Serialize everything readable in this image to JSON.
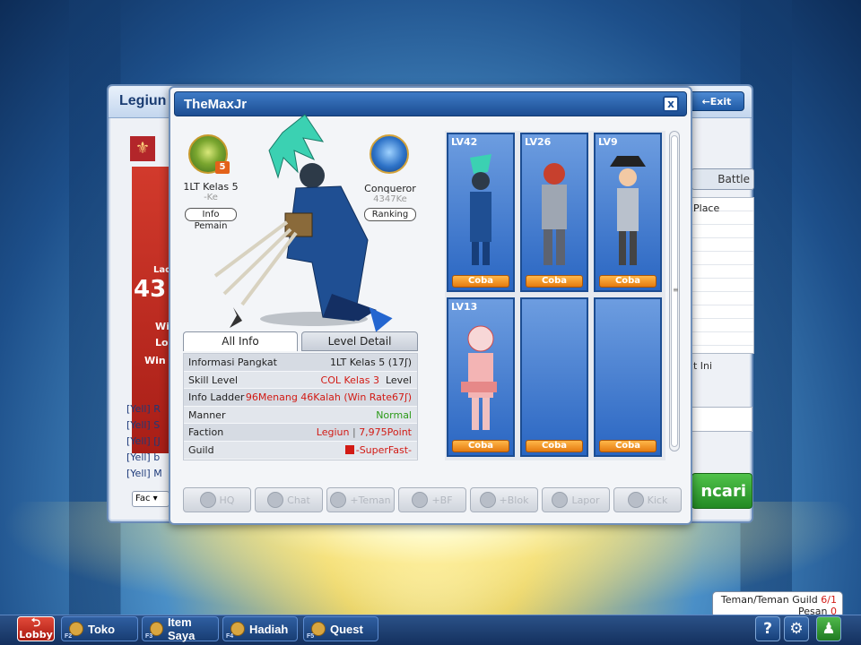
{
  "colors": {
    "accent": "#1c4d92",
    "red_text": "#d21a14",
    "green_text": "#2b9a18",
    "coba": "#e57b10"
  },
  "back_window": {
    "title": "Legiun",
    "exit_label": "Exit",
    "battle_label": "Battle",
    "place_label": "Place",
    "ini_label": "t Ini",
    "cari_label": "ncari",
    "fac_select": "Fac",
    "yell_lines": [
      "[Yell] R",
      "[Yell] S",
      "[Yell] [J",
      "[Yell] b",
      "[Yell] M"
    ],
    "red_card": {
      "ladder": "Lad",
      "big": "43",
      "wi": "Wi",
      "lo": "Lo",
      "win": "Win"
    }
  },
  "profile": {
    "title": "TheMaxJr",
    "close": "x",
    "rank": {
      "badge_num": "5",
      "label": "1LT Kelas 5",
      "ke": "-Ke",
      "button": "Info Pemain"
    },
    "conqueror": {
      "label": "Conqueror",
      "ke": "4347Ke",
      "button": "Ranking"
    },
    "tabs": {
      "all_info": "All Info",
      "level_detail": "Level Detail"
    },
    "info": [
      {
        "key": "Informasi Pangkat",
        "value": "1LT Kelas 5 (17ʃ)"
      },
      {
        "key": "Skill Level",
        "value_red": "COL Kelas 3",
        "value_dark": "Level"
      },
      {
        "key": "Info Ladder",
        "value": "96Menang 46Kalah (Win Rate67ʃ)"
      },
      {
        "key": "Manner",
        "value": "Normal"
      },
      {
        "key": "Faction",
        "value_red": "Legiun",
        "value_sep": "|",
        "value_red2": "7,975Point"
      },
      {
        "key": "Guild",
        "value": "-SuperFast-"
      }
    ],
    "slots": [
      {
        "level": "LV42",
        "button": "Coba"
      },
      {
        "level": "LV26",
        "button": "Coba"
      },
      {
        "level": "LV9",
        "button": "Coba"
      },
      {
        "level": "LV13",
        "button": "Coba"
      },
      {
        "level": "",
        "button": "Coba"
      },
      {
        "level": "",
        "button": "Coba"
      }
    ],
    "actions": [
      "HQ",
      "Chat",
      "+Teman",
      "+BF",
      "+Blok",
      "Lapor",
      "Kick"
    ]
  },
  "guild_box": {
    "line1": "Teman/Teman Guild",
    "line1_count": "6/1",
    "line2": "Pesan",
    "line2_count": "0"
  },
  "bottom_bar": {
    "lobby": "Lobby",
    "buttons": [
      {
        "key": "F2",
        "label": "Toko"
      },
      {
        "key": "F3",
        "label": "Item Saya"
      },
      {
        "key": "F4",
        "label": "Hadiah"
      },
      {
        "key": "F5",
        "label": "Quest"
      }
    ],
    "help": "?"
  }
}
